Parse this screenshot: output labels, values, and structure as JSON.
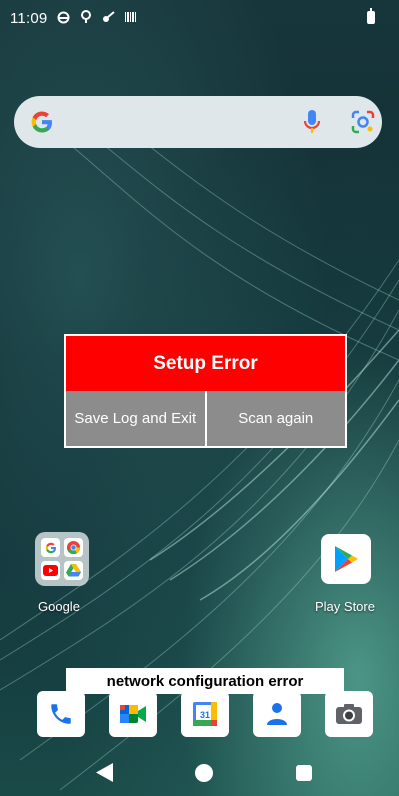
{
  "status_bar": {
    "time": "11:09",
    "icons": [
      "circle-status-icon",
      "voicemail-icon",
      "key-icon",
      "barcode-icon",
      "battery-icon"
    ]
  },
  "search_bar": {
    "logo_letter": "G",
    "icons": [
      "google-g-icon",
      "mic-icon",
      "lens-icon"
    ]
  },
  "dialog": {
    "title": "Setup Error",
    "buttons": {
      "save_log_exit": "Save Log and Exit",
      "scan_again": "Scan again"
    },
    "title_color": "#ff0000",
    "button_color": "#8c8c8c"
  },
  "home": {
    "folder_label": "Google",
    "folder_apps": [
      "google-search-icon",
      "chrome-icon",
      "youtube-icon",
      "drive-icon"
    ],
    "play_store_label": "Play Store"
  },
  "toast": {
    "message": "network configuration error"
  },
  "dock": {
    "apps": [
      "phone-icon",
      "meet-icon",
      "calendar-icon",
      "contacts-icon",
      "camera-icon"
    ],
    "calendar_day": "31"
  },
  "nav_bar": {
    "buttons": [
      "back",
      "home",
      "recents"
    ]
  }
}
